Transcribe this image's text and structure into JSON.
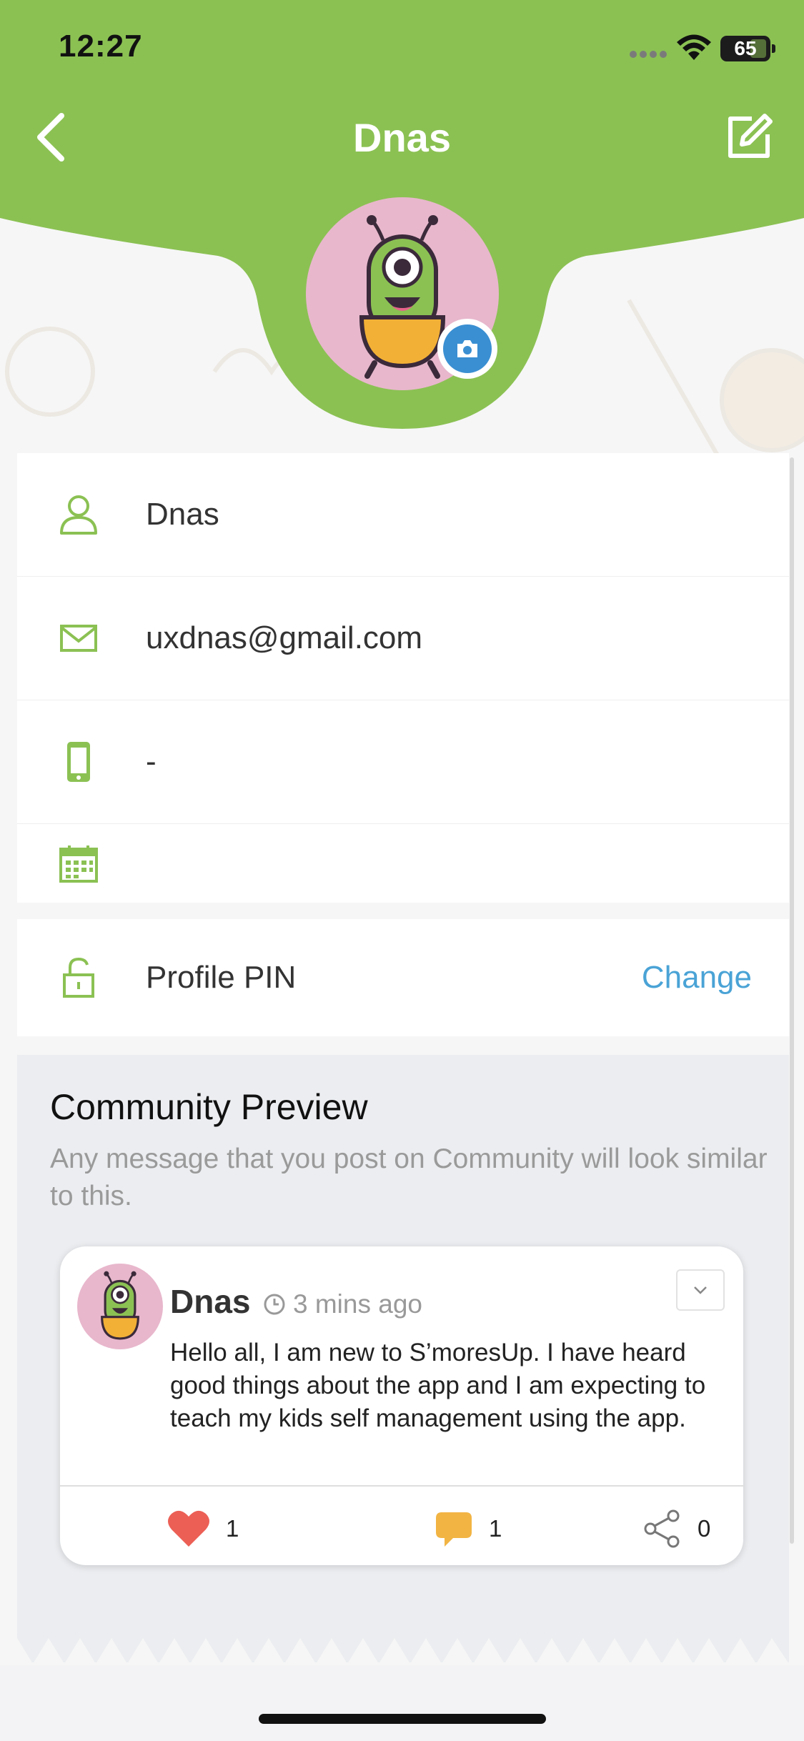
{
  "status_bar": {
    "time": "12:27",
    "battery": "65"
  },
  "header": {
    "title": "Dnas",
    "back_icon": "chevron-left-icon",
    "edit_icon": "edit-icon"
  },
  "profile": {
    "name": "Dnas",
    "email": "uxdnas@gmail.com",
    "phone": "-",
    "birthday": ""
  },
  "pin": {
    "label": "Profile PIN",
    "action": "Change"
  },
  "community_preview": {
    "title": "Community Preview",
    "description": "Any message that you post on Community will look similar to this.",
    "post": {
      "author": "Dnas",
      "time": "3 mins ago",
      "body": "Hello all, I am new to S’moresUp. I have heard good things about the app and I am expecting to teach my kids self management using the app.",
      "likes": "1",
      "comments": "1",
      "shares": "0"
    }
  },
  "colors": {
    "brand_green": "#8bc153",
    "link_blue": "#4aa3d6",
    "camera_blue": "#3a8fd2",
    "avatar_pink": "#e8b7cc"
  }
}
